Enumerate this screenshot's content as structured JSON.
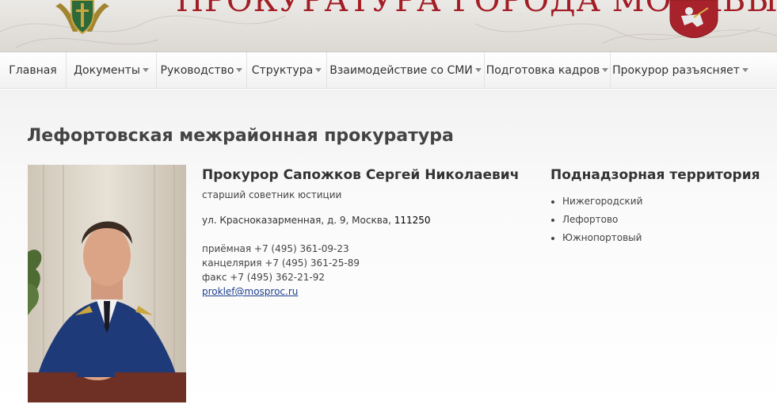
{
  "header": {
    "site_title": "ПРОКУРАТУРА ГОРОДА МОСКВЫ",
    "emblem_left": "prosecutor-emblem",
    "emblem_right": "moscow-coat-of-arms"
  },
  "nav": {
    "items": [
      {
        "label": "Главная",
        "dropdown": false
      },
      {
        "label": "Документы",
        "dropdown": true
      },
      {
        "label": "Руководство",
        "dropdown": true
      },
      {
        "label": "Структура",
        "dropdown": true
      },
      {
        "label": "Взаимодействие со СМИ",
        "dropdown": true
      },
      {
        "label": "Подготовка кадров",
        "dropdown": true
      },
      {
        "label": "Прокурор разъясняет",
        "dropdown": true
      }
    ]
  },
  "page": {
    "title": "Лефортовская межрайонная прокуратура"
  },
  "person": {
    "name": "Прокурор Сапожков Сергей Николаевич",
    "rank": "старший советник юстиции",
    "address": "ул. Красноказарменная, д. 9,  Москва, ",
    "zip": "111250",
    "reception": "приёмная +7 (495) 361-09-23",
    "office": "канцелярия +7 (495) 361-25-89",
    "fax": "факс +7 (495) 362-21-92",
    "email": "proklef@mosproc.ru"
  },
  "territory": {
    "title": "Поднадзорная территория",
    "items": [
      "Нижегородский",
      "Лефортово",
      "Южнопортовый"
    ]
  },
  "colors": {
    "title_red": "#a31d25",
    "link_blue": "#1d3e8f",
    "uniform_blue": "#1f3a78"
  }
}
